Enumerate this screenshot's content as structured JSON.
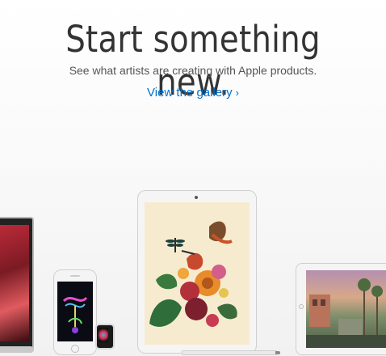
{
  "hero": {
    "headline": "Start something new.",
    "subhead": "See what artists are creating with Apple products.",
    "gallery_link": "View the gallery",
    "gallery_chevron": "›"
  },
  "colors": {
    "headline": "#333333",
    "subhead": "#555555",
    "link": "#0070c9",
    "background": "#f6f6f6"
  },
  "devices": [
    "macbook",
    "iphone",
    "apple-watch",
    "ipad-pro",
    "apple-pencil",
    "ipad"
  ]
}
